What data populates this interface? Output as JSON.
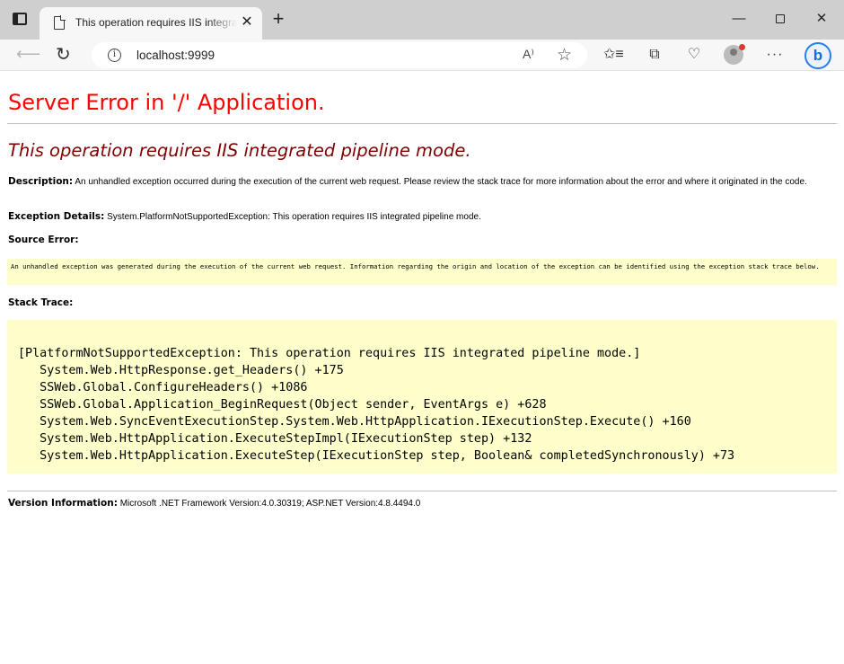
{
  "browser": {
    "tab_title": "This operation requires IIS integrated pipeline mode.",
    "tab_close": "✕",
    "new_tab": "+",
    "url": "localhost:9999",
    "read_aloud": "A⁾",
    "window_minimize": "—",
    "window_close": "✕",
    "more": "···",
    "bing": "b"
  },
  "page": {
    "heading": "Server Error in '/' Application.",
    "error_title": "This operation requires IIS integrated pipeline mode.",
    "description_label": "Description:",
    "description_text": "An unhandled exception occurred during the execution of the current web request. Please review the stack trace for more information about the error and where it originated in the code.",
    "exception_label": "Exception Details:",
    "exception_text": "System.PlatformNotSupportedException: This operation requires IIS integrated pipeline mode.",
    "source_error_label": "Source Error:",
    "source_error_text": "An unhandled exception was generated during the execution of the current web request. Information regarding the origin and location of the exception can be identified using the exception stack trace below.",
    "stack_trace_label": "Stack Trace:",
    "stack_trace": [
      "[PlatformNotSupportedException: This operation requires IIS integrated pipeline mode.]",
      "   System.Web.HttpResponse.get_Headers() +175",
      "   SSWeb.Global.ConfigureHeaders() +1086",
      "   SSWeb.Global.Application_BeginRequest(Object sender, EventArgs e) +628",
      "   System.Web.SyncEventExecutionStep.System.Web.HttpApplication.IExecutionStep.Execute() +160",
      "   System.Web.HttpApplication.ExecuteStepImpl(IExecutionStep step) +132",
      "   System.Web.HttpApplication.ExecuteStep(IExecutionStep step, Boolean& completedSynchronously) +73"
    ],
    "version_label": "Version Information:",
    "version_text": "Microsoft .NET Framework Version:4.0.30319; ASP.NET Version:4.8.4494.0"
  }
}
